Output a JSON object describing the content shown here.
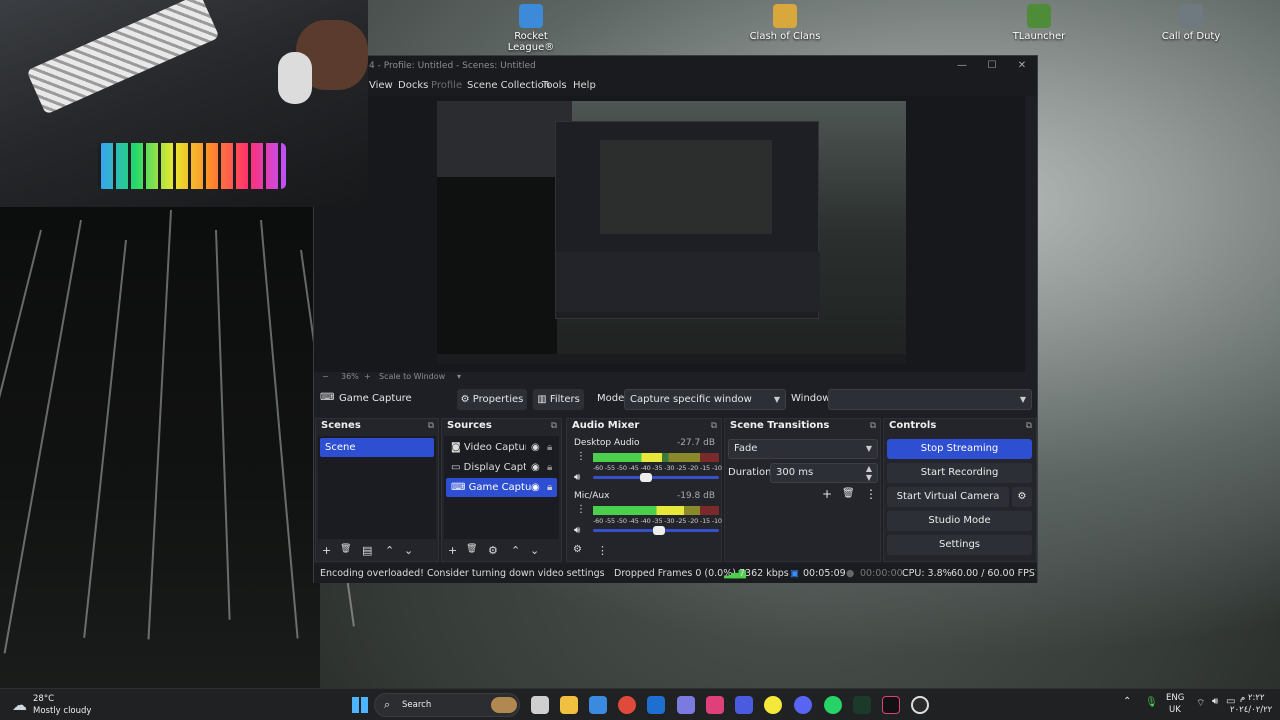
{
  "desktop": {
    "icons": [
      {
        "label": "Rocket League®",
        "icon": "rocket-league-icon",
        "color": "#3c8ad8"
      },
      {
        "label": "Clash of Clans",
        "icon": "clash-of-clans-icon",
        "color": "#d8a83c"
      },
      {
        "label": "TLauncher",
        "icon": "tlauncher-icon",
        "color": "#4f8c3a"
      },
      {
        "label": "Call of Duty",
        "icon": "call-of-duty-icon",
        "color": "#6f7a80"
      }
    ]
  },
  "obs": {
    "title": "4 - Profile: Untitled - Scenes: Untitled",
    "window_buttons": {
      "minimize": "—",
      "maximize": "☐",
      "close": "✕"
    },
    "menu": [
      "View",
      "Docks",
      "Profile",
      "Scene Collection",
      "Tools",
      "Help"
    ],
    "menu_disabled": "Profile",
    "zoom": {
      "minus": "−",
      "value": "36%",
      "plus": "+",
      "scale_label": "Scale to Window",
      "caret": "▾"
    },
    "source_toolbar": {
      "source_name": "Game Capture",
      "properties": "Properties",
      "filters": "Filters",
      "mode_label": "Mode",
      "mode_value": "Capture specific window",
      "window_label": "Window",
      "window_value": ""
    },
    "scenes": {
      "title": "Scenes",
      "items": [
        "Scene"
      ],
      "selected": 0,
      "footer": [
        "+",
        "🗑",
        "▤",
        "⌃",
        "⌄"
      ]
    },
    "sources": {
      "title": "Sources",
      "items": [
        {
          "label": "Video Capture Dev",
          "icon": "camera-icon"
        },
        {
          "label": "Display Capture",
          "icon": "monitor-icon"
        },
        {
          "label": "Game Capture",
          "icon": "gamepad-icon"
        }
      ],
      "selected": 2,
      "footer": [
        "+",
        "🗑",
        "⚙",
        "⌃",
        "⌄"
      ]
    },
    "audio_mixer": {
      "title": "Audio Mixer",
      "ticks": "-60 -55 -50 -45 -40 -35 -30 -25 -20 -15 -10 -5 -0",
      "channels": [
        {
          "name": "Desktop Audio",
          "db": "-27.7 dB",
          "level": 0.55,
          "volume": 0.42
        },
        {
          "name": "Mic/Aux",
          "db": "-19.8 dB",
          "level": 0.72,
          "volume": 0.52
        }
      ],
      "footer": [
        "⚙",
        "⋮"
      ]
    },
    "transitions": {
      "title": "Scene Transitions",
      "transition": "Fade",
      "duration_label": "Duration",
      "duration_value": "300 ms",
      "footer": [
        "+",
        "🗑",
        "⋮"
      ]
    },
    "controls": {
      "title": "Controls",
      "buttons": [
        "Stop Streaming",
        "Start Recording",
        "Start Virtual Camera",
        "Studio Mode",
        "Settings"
      ],
      "active": "Stop Streaming"
    },
    "status": {
      "message": "Encoding overloaded! Consider turning down video settings or using a fa",
      "dropped": "Dropped Frames 0 (0.0%)",
      "bitrate": "7362 kbps",
      "stream_time": "00:05:09",
      "rec_time": "00:00:00",
      "cpu": "CPU: 3.8%",
      "fps": "60.00 / 60.00 FPS"
    },
    "accent_color": "#2e4fd1"
  },
  "taskbar": {
    "weather_temp": "28°C",
    "weather_desc": "Mostly cloudy",
    "search": "Search",
    "lang_top": "ENG",
    "lang_bottom": "UK",
    "time": "٢:٢٢ م",
    "date": "٢٠٢٤/٠٢/٢٢"
  }
}
